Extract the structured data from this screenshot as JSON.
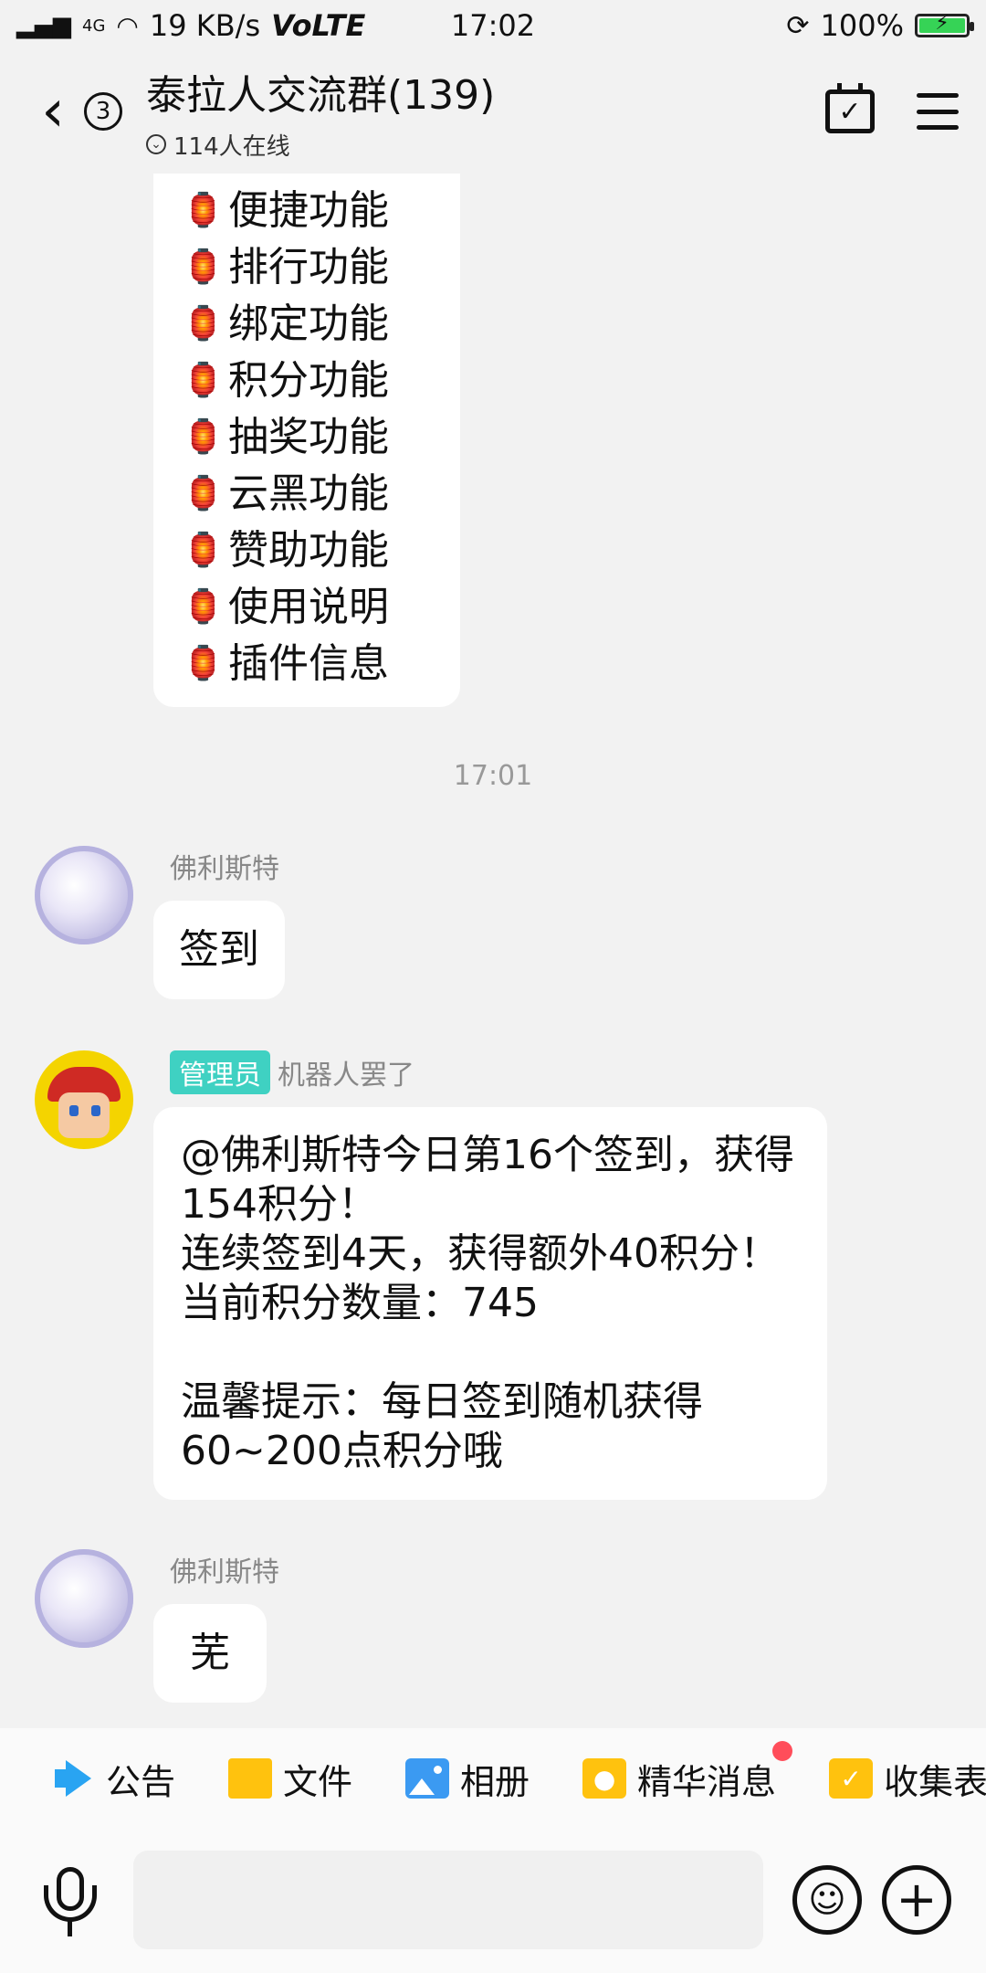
{
  "status_bar": {
    "network": "4G",
    "speed": "19 KB/s",
    "volte": "VoLTE",
    "time": "17:02",
    "battery": "100%",
    "battery_level": 1.0
  },
  "header": {
    "back_icon": "chevron-left-icon",
    "unread_count": "3",
    "group_title": "泰拉人交流群(139)",
    "online_text": "114人在线",
    "calendar_icon": "calendar-check-icon",
    "menu_icon": "hamburger-menu-icon"
  },
  "menu_message": {
    "icon": "lantern-icon",
    "items": [
      "便捷功能",
      "排行功能",
      "绑定功能",
      "积分功能",
      "抽奖功能",
      "云黑功能",
      "赞助功能",
      "使用说明",
      "插件信息"
    ]
  },
  "timestamp": "17:01",
  "messages": [
    {
      "sender": "佛利斯特",
      "text": "签到"
    },
    {
      "badge": "管理员",
      "sender": "机器人罢了",
      "text": "@佛利斯特今日第16个签到，获得\n154积分！\n连续签到4天，获得额外40积分！\n当前积分数量：745\n\n温馨提示：每日签到随机获得\n60~200点积分哦"
    },
    {
      "sender": "佛利斯特",
      "text": "芜"
    }
  ],
  "quick_bar": [
    {
      "label": "公告",
      "icon": "megaphone-icon"
    },
    {
      "label": "文件",
      "icon": "folder-icon"
    },
    {
      "label": "相册",
      "icon": "photo-album-icon"
    },
    {
      "label": "精华消息",
      "icon": "essence-icon",
      "unread_dot": true
    },
    {
      "label": "收集表",
      "icon": "collect-form-icon"
    }
  ],
  "input_bar": {
    "mic_icon": "microphone-icon",
    "placeholder": "",
    "emoji_icon": "smiley-icon",
    "plus_icon": "plus-icon"
  },
  "colors": {
    "background": "#f2f2f2",
    "bubble": "#ffffff",
    "admin_badge": "#3fd1c2",
    "battery_fill": "#36d356",
    "red_dot": "#ff4d5a"
  }
}
